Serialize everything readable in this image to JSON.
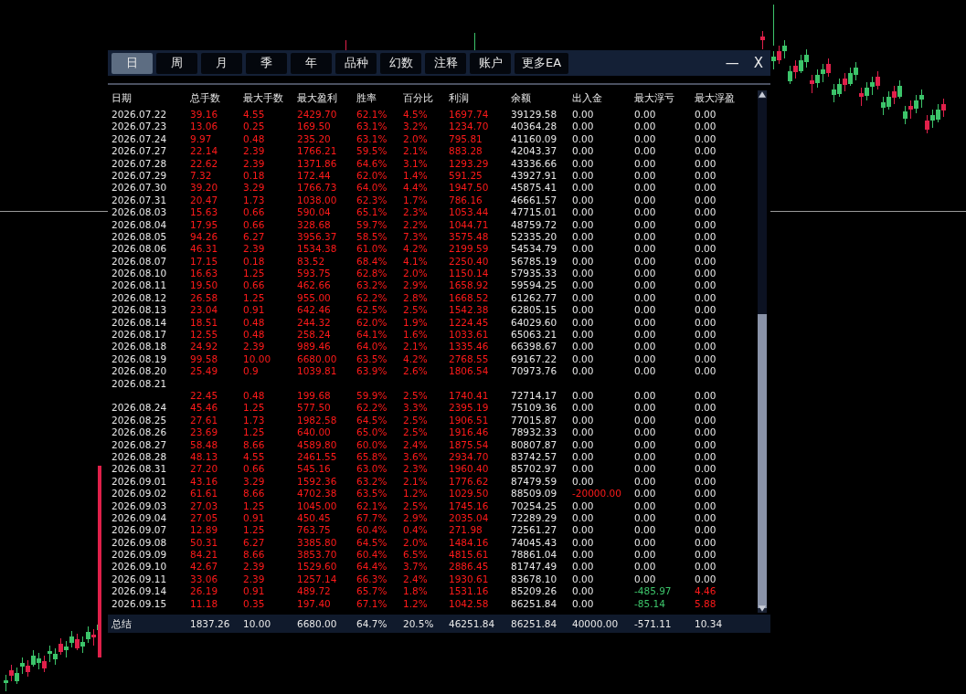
{
  "tabs": [
    {
      "label": "日",
      "selected": true
    },
    {
      "label": "周",
      "selected": false
    },
    {
      "label": "月",
      "selected": false
    },
    {
      "label": "季",
      "selected": false
    },
    {
      "label": "年",
      "selected": false
    },
    {
      "label": "品种",
      "selected": false
    },
    {
      "label": "幻数",
      "selected": false
    },
    {
      "label": "注释",
      "selected": false
    },
    {
      "label": "账户",
      "selected": false
    },
    {
      "label": "更多EA",
      "selected": false
    }
  ],
  "window_controls": {
    "minimize": "—",
    "close": "X"
  },
  "table": {
    "columns": [
      {
        "label": "日期",
        "color": "#e8e8e8"
      },
      {
        "label": "总手数",
        "color": "#ff1a1a"
      },
      {
        "label": "最大手数",
        "color": "#ff1a1a"
      },
      {
        "label": "最大盈利",
        "color": "#ff1a1a"
      },
      {
        "label": "胜率",
        "color": "#ff1a1a"
      },
      {
        "label": "百分比",
        "color": "#ff1a1a"
      },
      {
        "label": "利润",
        "color": "#ff1a1a"
      },
      {
        "label": "余额",
        "color": "#e8e8e8"
      },
      {
        "label": "出入金",
        "color": "#e8e8e8"
      },
      {
        "label": "最大浮亏",
        "color": "#e8e8e8"
      },
      {
        "label": "最大浮盈",
        "color": "#e8e8e8"
      }
    ],
    "rows": [
      {
        "date": "2026.07.22",
        "values": [
          "39.16",
          "4.55",
          "2429.70",
          "62.1%",
          "4.5%",
          "1697.74",
          "39129.58",
          "0.00",
          "0.00",
          "0.00"
        ]
      },
      {
        "date": "2026.07.23",
        "values": [
          "13.06",
          "0.25",
          "169.50",
          "63.1%",
          "3.2%",
          "1234.70",
          "40364.28",
          "0.00",
          "0.00",
          "0.00"
        ]
      },
      {
        "date": "2026.07.24",
        "values": [
          "9.97",
          "0.48",
          "235.20",
          "63.1%",
          "2.0%",
          "795.81",
          "41160.09",
          "0.00",
          "0.00",
          "0.00"
        ]
      },
      {
        "date": "2026.07.27",
        "values": [
          "22.14",
          "2.39",
          "1766.21",
          "59.5%",
          "2.1%",
          "883.28",
          "42043.37",
          "0.00",
          "0.00",
          "0.00"
        ]
      },
      {
        "date": "2026.07.28",
        "values": [
          "22.62",
          "2.39",
          "1371.86",
          "64.6%",
          "3.1%",
          "1293.29",
          "43336.66",
          "0.00",
          "0.00",
          "0.00"
        ]
      },
      {
        "date": "2026.07.29",
        "values": [
          "7.32",
          "0.18",
          "172.44",
          "62.0%",
          "1.4%",
          "591.25",
          "43927.91",
          "0.00",
          "0.00",
          "0.00"
        ]
      },
      {
        "date": "2026.07.30",
        "values": [
          "39.20",
          "3.29",
          "1766.73",
          "64.0%",
          "4.4%",
          "1947.50",
          "45875.41",
          "0.00",
          "0.00",
          "0.00"
        ]
      },
      {
        "date": "2026.07.31",
        "values": [
          "20.47",
          "1.73",
          "1038.00",
          "62.3%",
          "1.7%",
          "786.16",
          "46661.57",
          "0.00",
          "0.00",
          "0.00"
        ]
      },
      {
        "date": "2026.08.03",
        "values": [
          "15.63",
          "0.66",
          "590.04",
          "65.1%",
          "2.3%",
          "1053.44",
          "47715.01",
          "0.00",
          "0.00",
          "0.00"
        ]
      },
      {
        "date": "2026.08.04",
        "values": [
          "17.95",
          "0.66",
          "328.68",
          "59.7%",
          "2.2%",
          "1044.71",
          "48759.72",
          "0.00",
          "0.00",
          "0.00"
        ]
      },
      {
        "date": "2026.08.05",
        "values": [
          "94.26",
          "6.27",
          "3956.37",
          "58.5%",
          "7.3%",
          "3575.48",
          "52335.20",
          "0.00",
          "0.00",
          "0.00"
        ]
      },
      {
        "date": "2026.08.06",
        "values": [
          "46.31",
          "2.39",
          "1534.38",
          "61.0%",
          "4.2%",
          "2199.59",
          "54534.79",
          "0.00",
          "0.00",
          "0.00"
        ]
      },
      {
        "date": "2026.08.07",
        "values": [
          "17.15",
          "0.18",
          "83.52",
          "68.4%",
          "4.1%",
          "2250.40",
          "56785.19",
          "0.00",
          "0.00",
          "0.00"
        ]
      },
      {
        "date": "2026.08.10",
        "values": [
          "16.63",
          "1.25",
          "593.75",
          "62.8%",
          "2.0%",
          "1150.14",
          "57935.33",
          "0.00",
          "0.00",
          "0.00"
        ]
      },
      {
        "date": "2026.08.11",
        "values": [
          "19.50",
          "0.66",
          "462.66",
          "63.2%",
          "2.9%",
          "1658.92",
          "59594.25",
          "0.00",
          "0.00",
          "0.00"
        ]
      },
      {
        "date": "2026.08.12",
        "values": [
          "26.58",
          "1.25",
          "955.00",
          "62.2%",
          "2.8%",
          "1668.52",
          "61262.77",
          "0.00",
          "0.00",
          "0.00"
        ]
      },
      {
        "date": "2026.08.13",
        "values": [
          "23.04",
          "0.91",
          "642.46",
          "62.5%",
          "2.5%",
          "1542.38",
          "62805.15",
          "0.00",
          "0.00",
          "0.00"
        ]
      },
      {
        "date": "2026.08.14",
        "values": [
          "18.51",
          "0.48",
          "244.32",
          "62.0%",
          "1.9%",
          "1224.45",
          "64029.60",
          "0.00",
          "0.00",
          "0.00"
        ]
      },
      {
        "date": "2026.08.17",
        "values": [
          "12.55",
          "0.48",
          "258.24",
          "64.1%",
          "1.6%",
          "1033.61",
          "65063.21",
          "0.00",
          "0.00",
          "0.00"
        ]
      },
      {
        "date": "2026.08.18",
        "values": [
          "24.92",
          "2.39",
          "989.46",
          "64.0%",
          "2.1%",
          "1335.46",
          "66398.67",
          "0.00",
          "0.00",
          "0.00"
        ]
      },
      {
        "date": "2026.08.19",
        "values": [
          "99.58",
          "10.00",
          "6680.00",
          "63.5%",
          "4.2%",
          "2768.55",
          "69167.22",
          "0.00",
          "0.00",
          "0.00"
        ]
      },
      {
        "date": "2026.08.20",
        "values": [
          "25.49",
          "0.9",
          "1039.81",
          "63.9%",
          "2.6%",
          "1806.54",
          "70973.76",
          "0.00",
          "0.00",
          "0.00"
        ]
      },
      {
        "date": "2026.08.21"
      },
      {
        "values": [
          "22.45",
          "0.48",
          "199.68",
          "59.9%",
          "2.5%",
          "1740.41",
          "72714.17",
          "0.00",
          "0.00",
          "0.00"
        ]
      },
      {
        "date": "2026.08.24",
        "values": [
          "45.46",
          "1.25",
          "577.50",
          "62.2%",
          "3.3%",
          "2395.19",
          "75109.36",
          "0.00",
          "0.00",
          "0.00"
        ]
      },
      {
        "date": "2026.08.25",
        "values": [
          "27.61",
          "1.73",
          "1982.58",
          "64.5%",
          "2.5%",
          "1906.51",
          "77015.87",
          "0.00",
          "0.00",
          "0.00"
        ]
      },
      {
        "date": "2026.08.26",
        "values": [
          "23.69",
          "1.25",
          "640.00",
          "65.0%",
          "2.5%",
          "1916.46",
          "78932.33",
          "0.00",
          "0.00",
          "0.00"
        ]
      },
      {
        "date": "2026.08.27",
        "values": [
          "58.48",
          "8.66",
          "4589.80",
          "60.0%",
          "2.4%",
          "1875.54",
          "80807.87",
          "0.00",
          "0.00",
          "0.00"
        ]
      },
      {
        "date": "2026.08.28",
        "values": [
          "48.13",
          "4.55",
          "2461.55",
          "65.8%",
          "3.6%",
          "2934.70",
          "83742.57",
          "0.00",
          "0.00",
          "0.00"
        ]
      },
      {
        "date": "2026.08.31",
        "values": [
          "27.20",
          "0.66",
          "545.16",
          "63.0%",
          "2.3%",
          "1960.40",
          "85702.97",
          "0.00",
          "0.00",
          "0.00"
        ]
      },
      {
        "date": "2026.09.01",
        "values": [
          "43.16",
          "3.29",
          "1592.36",
          "63.2%",
          "2.1%",
          "1776.62",
          "87479.59",
          "0.00",
          "0.00",
          "0.00"
        ]
      },
      {
        "date": "2026.09.02",
        "values": [
          "61.61",
          "8.66",
          "4702.38",
          "63.5%",
          "1.2%",
          "1029.50",
          "88509.09",
          "-20000.00",
          "0.00",
          "0.00"
        ],
        "cell_colors": [
          {
            "color": "#ff1a1a"
          },
          {
            "color": "#ff1a1a"
          },
          {
            "color": "#ff1a1a"
          },
          {
            "color": "#ff1a1a"
          },
          {
            "color": "#ff1a1a"
          },
          {
            "color": "#ff1a1a"
          },
          {
            "color": "#e8e8e8"
          },
          {
            "color": "#ff1a1a"
          },
          {
            "color": "#e8e8e8"
          },
          {
            "color": "#e8e8e8"
          }
        ]
      },
      {
        "date": "2026.09.03",
        "values": [
          "27.03",
          "1.25",
          "1045.00",
          "62.1%",
          "2.5%",
          "1745.16",
          "70254.25",
          "0.00",
          "0.00",
          "0.00"
        ]
      },
      {
        "date": "2026.09.04",
        "values": [
          "27.05",
          "0.91",
          "450.45",
          "67.7%",
          "2.9%",
          "2035.04",
          "72289.29",
          "0.00",
          "0.00",
          "0.00"
        ]
      },
      {
        "date": "2026.09.07",
        "values": [
          "12.89",
          "1.25",
          "763.75",
          "60.4%",
          "0.4%",
          "271.98",
          "72561.27",
          "0.00",
          "0.00",
          "0.00"
        ]
      },
      {
        "date": "2026.09.08",
        "values": [
          "50.31",
          "6.27",
          "3385.80",
          "64.5%",
          "2.0%",
          "1484.16",
          "74045.43",
          "0.00",
          "0.00",
          "0.00"
        ]
      },
      {
        "date": "2026.09.09",
        "values": [
          "84.21",
          "8.66",
          "3853.70",
          "60.4%",
          "6.5%",
          "4815.61",
          "78861.04",
          "0.00",
          "0.00",
          "0.00"
        ]
      },
      {
        "date": "2026.09.10",
        "values": [
          "42.67",
          "2.39",
          "1529.60",
          "64.4%",
          "3.7%",
          "2886.45",
          "81747.49",
          "0.00",
          "0.00",
          "0.00"
        ]
      },
      {
        "date": "2026.09.11",
        "values": [
          "33.06",
          "2.39",
          "1257.14",
          "66.3%",
          "2.4%",
          "1930.61",
          "83678.10",
          "0.00",
          "0.00",
          "0.00"
        ]
      },
      {
        "date": "2026.09.14",
        "values": [
          "26.19",
          "0.91",
          "489.72",
          "65.7%",
          "1.8%",
          "1531.16",
          "85209.26",
          "0.00",
          "-485.97",
          "4.46"
        ],
        "cell_colors": [
          {
            "color": "#ff1a1a"
          },
          {
            "color": "#ff1a1a"
          },
          {
            "color": "#ff1a1a"
          },
          {
            "color": "#ff1a1a"
          },
          {
            "color": "#ff1a1a"
          },
          {
            "color": "#ff1a1a"
          },
          {
            "color": "#e8e8e8"
          },
          {
            "color": "#e8e8e8"
          },
          {
            "color": "#3cc46a"
          },
          {
            "color": "#ff1a1a"
          }
        ]
      },
      {
        "date": "2026.09.15",
        "values": [
          "11.18",
          "0.35",
          "197.40",
          "67.1%",
          "1.2%",
          "1042.58",
          "86251.84",
          "0.00",
          "-85.14",
          "5.88"
        ],
        "cell_colors": [
          {
            "color": "#ff1a1a"
          },
          {
            "color": "#ff1a1a"
          },
          {
            "color": "#ff1a1a"
          },
          {
            "color": "#ff1a1a"
          },
          {
            "color": "#ff1a1a"
          },
          {
            "color": "#ff1a1a"
          },
          {
            "color": "#e8e8e8"
          },
          {
            "color": "#e8e8e8"
          },
          {
            "color": "#3cc46a"
          },
          {
            "color": "#ff1a1a"
          }
        ]
      }
    ]
  },
  "summary": {
    "label": "总结",
    "values": [
      "1837.26",
      "10.00",
      "6680.00",
      "64.7%",
      "20.5%",
      "46251.84",
      "86251.84",
      "40000.00",
      "-571.11",
      "10.34"
    ]
  }
}
